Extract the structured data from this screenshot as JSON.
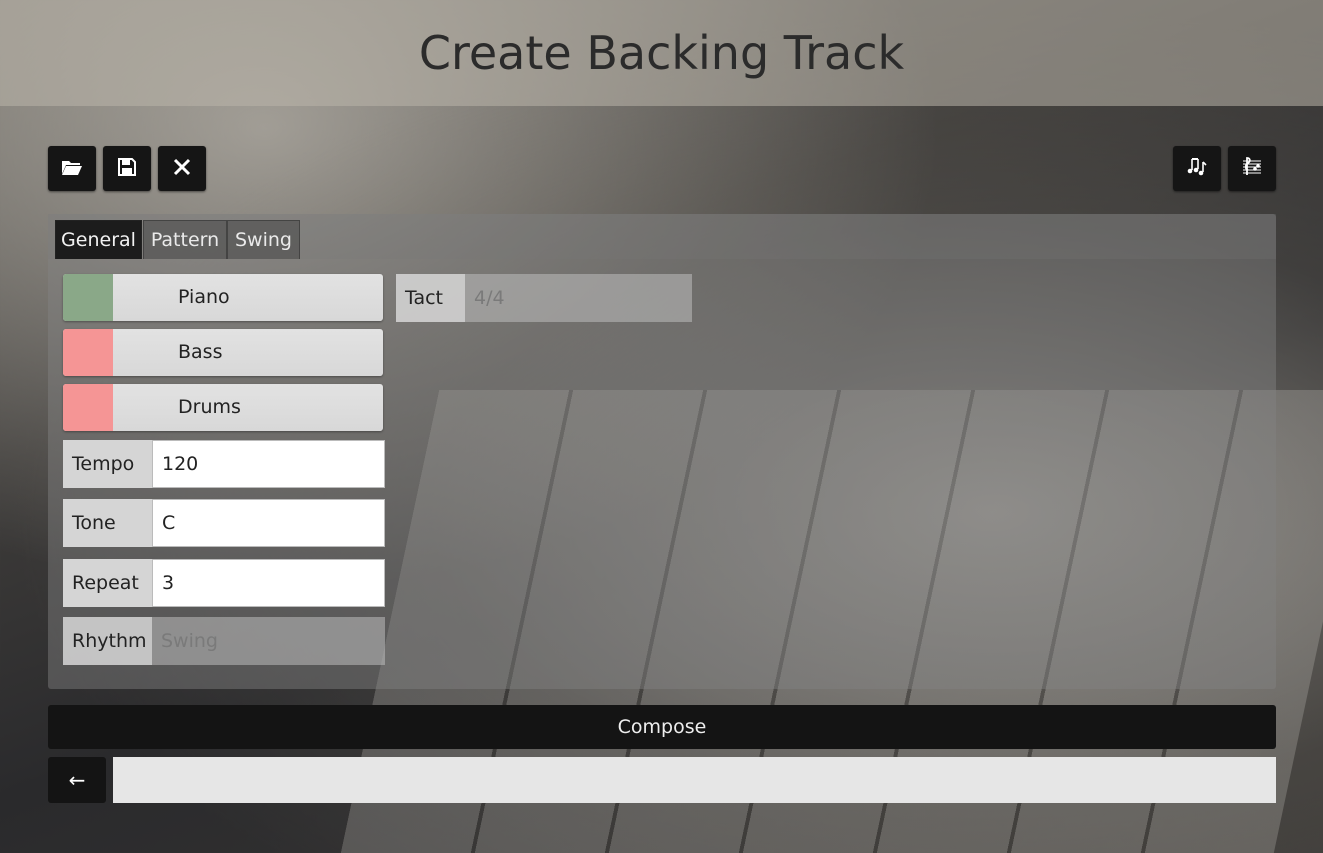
{
  "header": {
    "title": "Create Backing Track"
  },
  "toolbar": {
    "left": [
      {
        "name": "open-button",
        "icon": "folder-open-icon",
        "glyph": "📂"
      },
      {
        "name": "save-button",
        "icon": "floppy-disk-icon",
        "glyph": "💾"
      },
      {
        "name": "close-button",
        "icon": "close-icon",
        "glyph": "✕"
      }
    ],
    "right": [
      {
        "name": "notes-button",
        "icon": "music-notes-icon",
        "glyph": "♫"
      },
      {
        "name": "score-button",
        "icon": "sheet-music-icon",
        "glyph": "𝄞"
      }
    ]
  },
  "tabs": [
    {
      "label": "General",
      "active": true
    },
    {
      "label": "Pattern",
      "active": false
    },
    {
      "label": "Swing",
      "active": false
    }
  ],
  "instruments": [
    {
      "label": "Piano",
      "color": "#8aa888",
      "enabled": true
    },
    {
      "label": "Bass",
      "color": "#f59595",
      "enabled": false
    },
    {
      "label": "Drums",
      "color": "#f59595",
      "enabled": false
    }
  ],
  "fields": {
    "tempo": {
      "label": "Tempo",
      "value": "120"
    },
    "tone": {
      "label": "Tone",
      "value": "C"
    },
    "repeat": {
      "label": "Repeat",
      "value": "3"
    },
    "rhythm": {
      "label": "Rhythm",
      "value": "Swing"
    },
    "tact": {
      "label": "Tact",
      "value": "4/4"
    }
  },
  "compose": {
    "label": "Compose"
  },
  "back": {
    "label": "←"
  },
  "bottom_input": {
    "value": ""
  }
}
